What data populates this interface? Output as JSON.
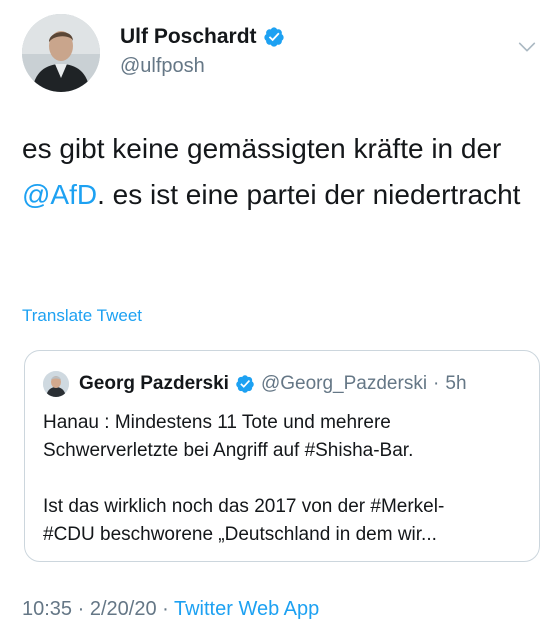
{
  "author": {
    "name": "Ulf Poschardt",
    "handle": "@ulfposh",
    "verified": true
  },
  "tweet": {
    "text_before": "es gibt keine gemässigten kräfte in der ",
    "mention": "@AfD",
    "text_after": ". es ist eine partei der niedertracht"
  },
  "translate_label": "Translate Tweet",
  "quoted": {
    "name": "Georg Pazderski",
    "handle": "@Georg_Pazderski",
    "dot": "·",
    "time": "5h",
    "line1": "Hanau : Mindestens 11 Tote und mehrere",
    "line2": "Schwerverletzte bei Angriff auf #Shisha-Bar.",
    "line3": "Ist das wirklich noch das 2017 von der #Merkel-",
    "line4": "#CDU beschworene „Deutschland in dem wir..."
  },
  "footer": {
    "time": "10:35",
    "sep1": " · ",
    "date": "2/20/20",
    "sep2": " · ",
    "app": "Twitter Web App"
  },
  "colors": {
    "link": "#1da1f2",
    "muted": "#657786",
    "text": "#14171a",
    "border": "#ccd6dd"
  },
  "icons": [
    "avatar",
    "verified-badge-icon",
    "chevron-down-icon"
  ]
}
